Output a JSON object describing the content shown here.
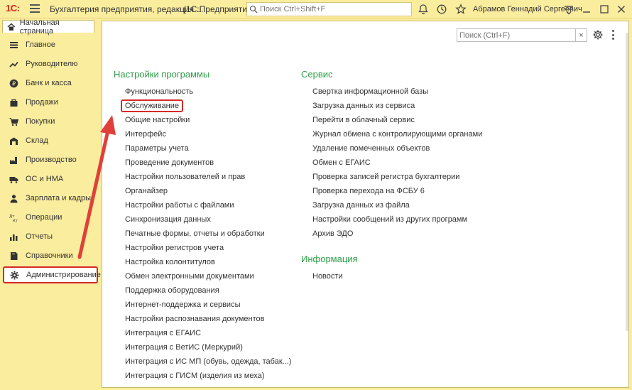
{
  "titlebar": {
    "logo": "1С:",
    "app_title": "Бухгалтерия предприятия, редакция ...",
    "app_mode": "(1С:Предприятие)",
    "search_placeholder": "Поиск Ctrl+Shift+F",
    "user_name": "Абрамов Геннадий Сергеевич"
  },
  "tabs": {
    "home_label": "Начальная страница"
  },
  "sidebar": {
    "items": [
      {
        "label": "Главное",
        "icon": "list-icon"
      },
      {
        "label": "Руководителю",
        "icon": "trend-icon"
      },
      {
        "label": "Банк и касса",
        "icon": "ruble-icon"
      },
      {
        "label": "Продажи",
        "icon": "bag-icon"
      },
      {
        "label": "Покупки",
        "icon": "cart-icon"
      },
      {
        "label": "Склад",
        "icon": "warehouse-icon"
      },
      {
        "label": "Производство",
        "icon": "factory-icon"
      },
      {
        "label": "ОС и НМА",
        "icon": "truck-icon"
      },
      {
        "label": "Зарплата и кадры",
        "icon": "person-icon"
      },
      {
        "label": "Операции",
        "icon": "dtkt-icon"
      },
      {
        "label": "Отчеты",
        "icon": "barchart-icon"
      },
      {
        "label": "Справочники",
        "icon": "book-icon"
      },
      {
        "label": "Администрирование",
        "icon": "gear-icon"
      }
    ],
    "active_index": 12
  },
  "main": {
    "search_placeholder": "Поиск (Ctrl+F)",
    "clear_label": "×",
    "settings": {
      "title": "Настройки программы",
      "items": [
        "Функциональность",
        "Обслуживание",
        "Общие настройки",
        "Интерфейс",
        "Параметры учета",
        "Проведение документов",
        "Настройки пользователей и прав",
        "Органайзер",
        "Настройки работы с файлами",
        "Синхронизация данных",
        "Печатные формы, отчеты и обработки",
        "Настройки регистров учета",
        "Настройка колонтитулов",
        "Обмен электронными документами",
        "Поддержка оборудования",
        "Интернет-поддержка и сервисы",
        "Настройки распознавания документов",
        "Интеграция с ЕГАИС",
        "Интеграция с ВетИС (Меркурий)",
        "Интеграция с ИС МП (обувь, одежда, табак...)",
        "Интеграция с ГИСМ (изделия из меха)"
      ],
      "highlighted_index": 1
    },
    "service": {
      "title": "Сервис",
      "items": [
        "Свертка информационной базы",
        "Загрузка данных из сервиса",
        "Перейти в облачный сервис",
        "Журнал обмена с контролирующими органами",
        "Удаление помеченных объектов",
        "Обмен с ЕГАИС",
        "Проверка записей регистра бухгалтерии",
        "Проверка перехода на ФСБУ 6",
        "Загрузка данных из файла",
        "Настройки сообщений из других программ",
        "Архив ЭДО"
      ]
    },
    "info": {
      "title": "Информация",
      "items": [
        "Новости"
      ]
    }
  },
  "colors": {
    "accent_red": "#d42a2a",
    "section_green": "#2e9d47",
    "panel_yellow": "#fbed9e"
  }
}
